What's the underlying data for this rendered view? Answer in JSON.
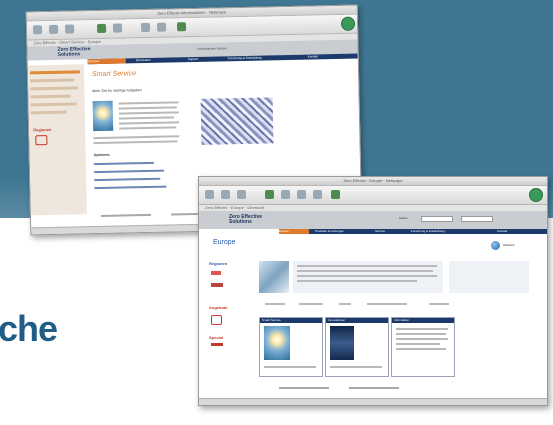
{
  "background": {
    "band_color": "#3f7693",
    "headline_fragment": "che",
    "headline_color": "#1f5d86"
  },
  "window_back": {
    "title": "Zero Effectiv Informationen · Netscape",
    "address": "Zero Effectiv · Smart Service · Europe",
    "site_logo_line1": "Zero Effective",
    "site_logo_line2": "Solutions",
    "header_label": "Informationen Europa",
    "nav_tabs": [
      "Services",
      "Information",
      "Support",
      "Forschung & Entwicklung",
      "Kontakt"
    ],
    "heading": "Smart Service",
    "subheading": "Mehr Zeit für wichtige Aufgaben",
    "links_heading": "Optionen:",
    "sidebar_label": "Regionen",
    "icons": [
      "bulb-image",
      "texture-image"
    ]
  },
  "window_front": {
    "title": "Zero Effectiv · Europe · Netscape",
    "address": "Zero Effectiv · Europe · Übersicht",
    "site_logo_line1": "Zero Effective",
    "site_logo_line2": "Solutions",
    "search_label": "Suche",
    "nav_tabs": [
      "Europe",
      "Produkte & Lösungen",
      "Service",
      "Forschung & Entwicklung",
      "Kontakt"
    ],
    "heading": "Europe",
    "globe_label": "Weltweit",
    "sidebar_labels": [
      "Regionen",
      "Angebote",
      "Special"
    ],
    "boxes": [
      "Smart Service",
      "Innovationen",
      "Information"
    ],
    "icons": [
      "photo-image",
      "bulb-image",
      "dark-image"
    ]
  }
}
